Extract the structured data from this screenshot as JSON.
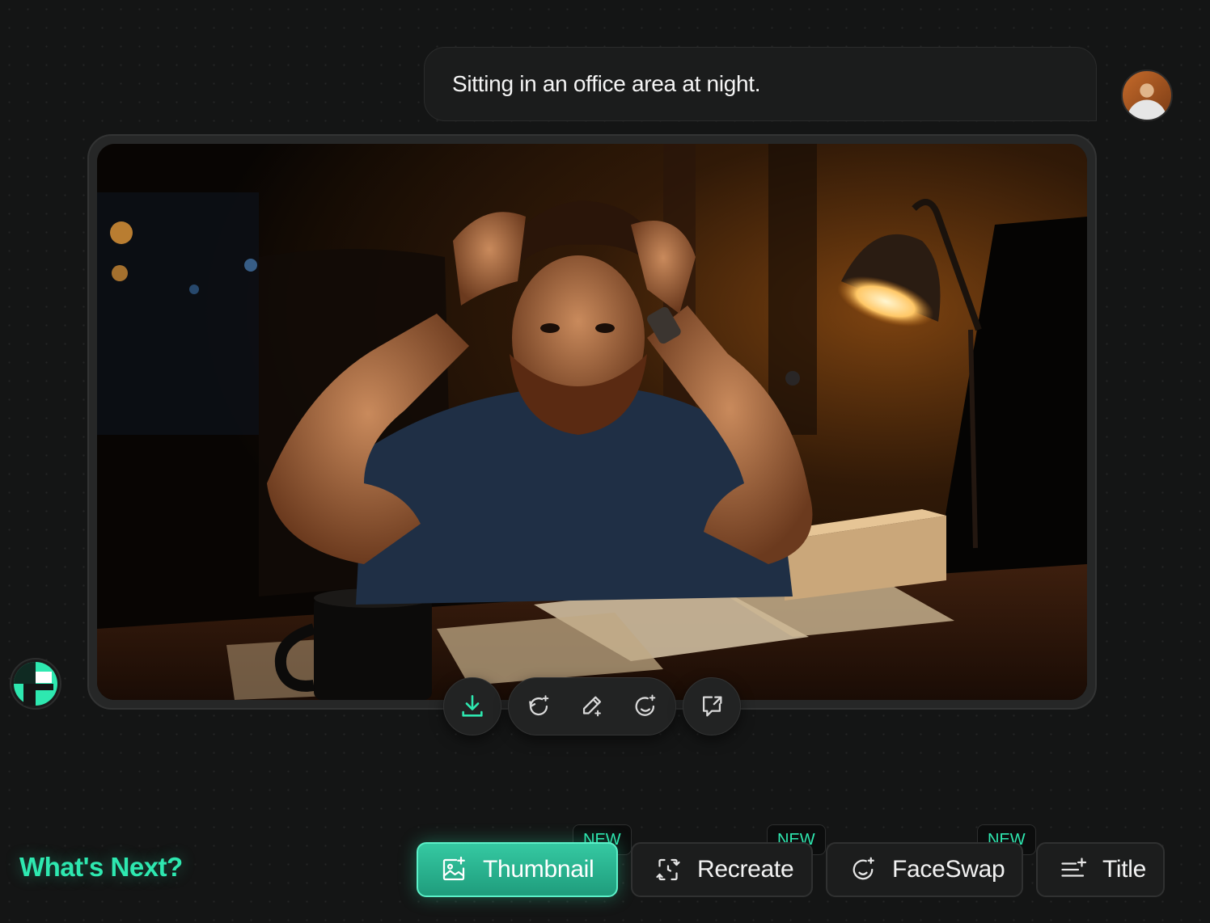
{
  "prompt": {
    "text": "Sitting in an office area at night."
  },
  "image_actions": {
    "download": "download-icon",
    "regenerate": "regenerate-sparkle-icon",
    "edit": "magic-pencil-icon",
    "faceswap": "face-sparkle-icon",
    "share": "share-comment-icon"
  },
  "whats_next": {
    "heading": "What's Next?",
    "buttons": [
      {
        "label": "Thumbnail",
        "badge": "NEW",
        "icon": "image-sparkle-icon",
        "active": true
      },
      {
        "label": "Recreate",
        "badge": "NEW",
        "icon": "recreate-icon",
        "active": false
      },
      {
        "label": "FaceSwap",
        "badge": "NEW",
        "icon": "face-sparkle-icon",
        "active": false
      },
      {
        "label": "Title",
        "badge": "",
        "icon": "title-sparkle-icon",
        "active": false
      }
    ]
  },
  "colors": {
    "accent": "#2ee8b0",
    "background": "#141515",
    "card": "#262727"
  }
}
